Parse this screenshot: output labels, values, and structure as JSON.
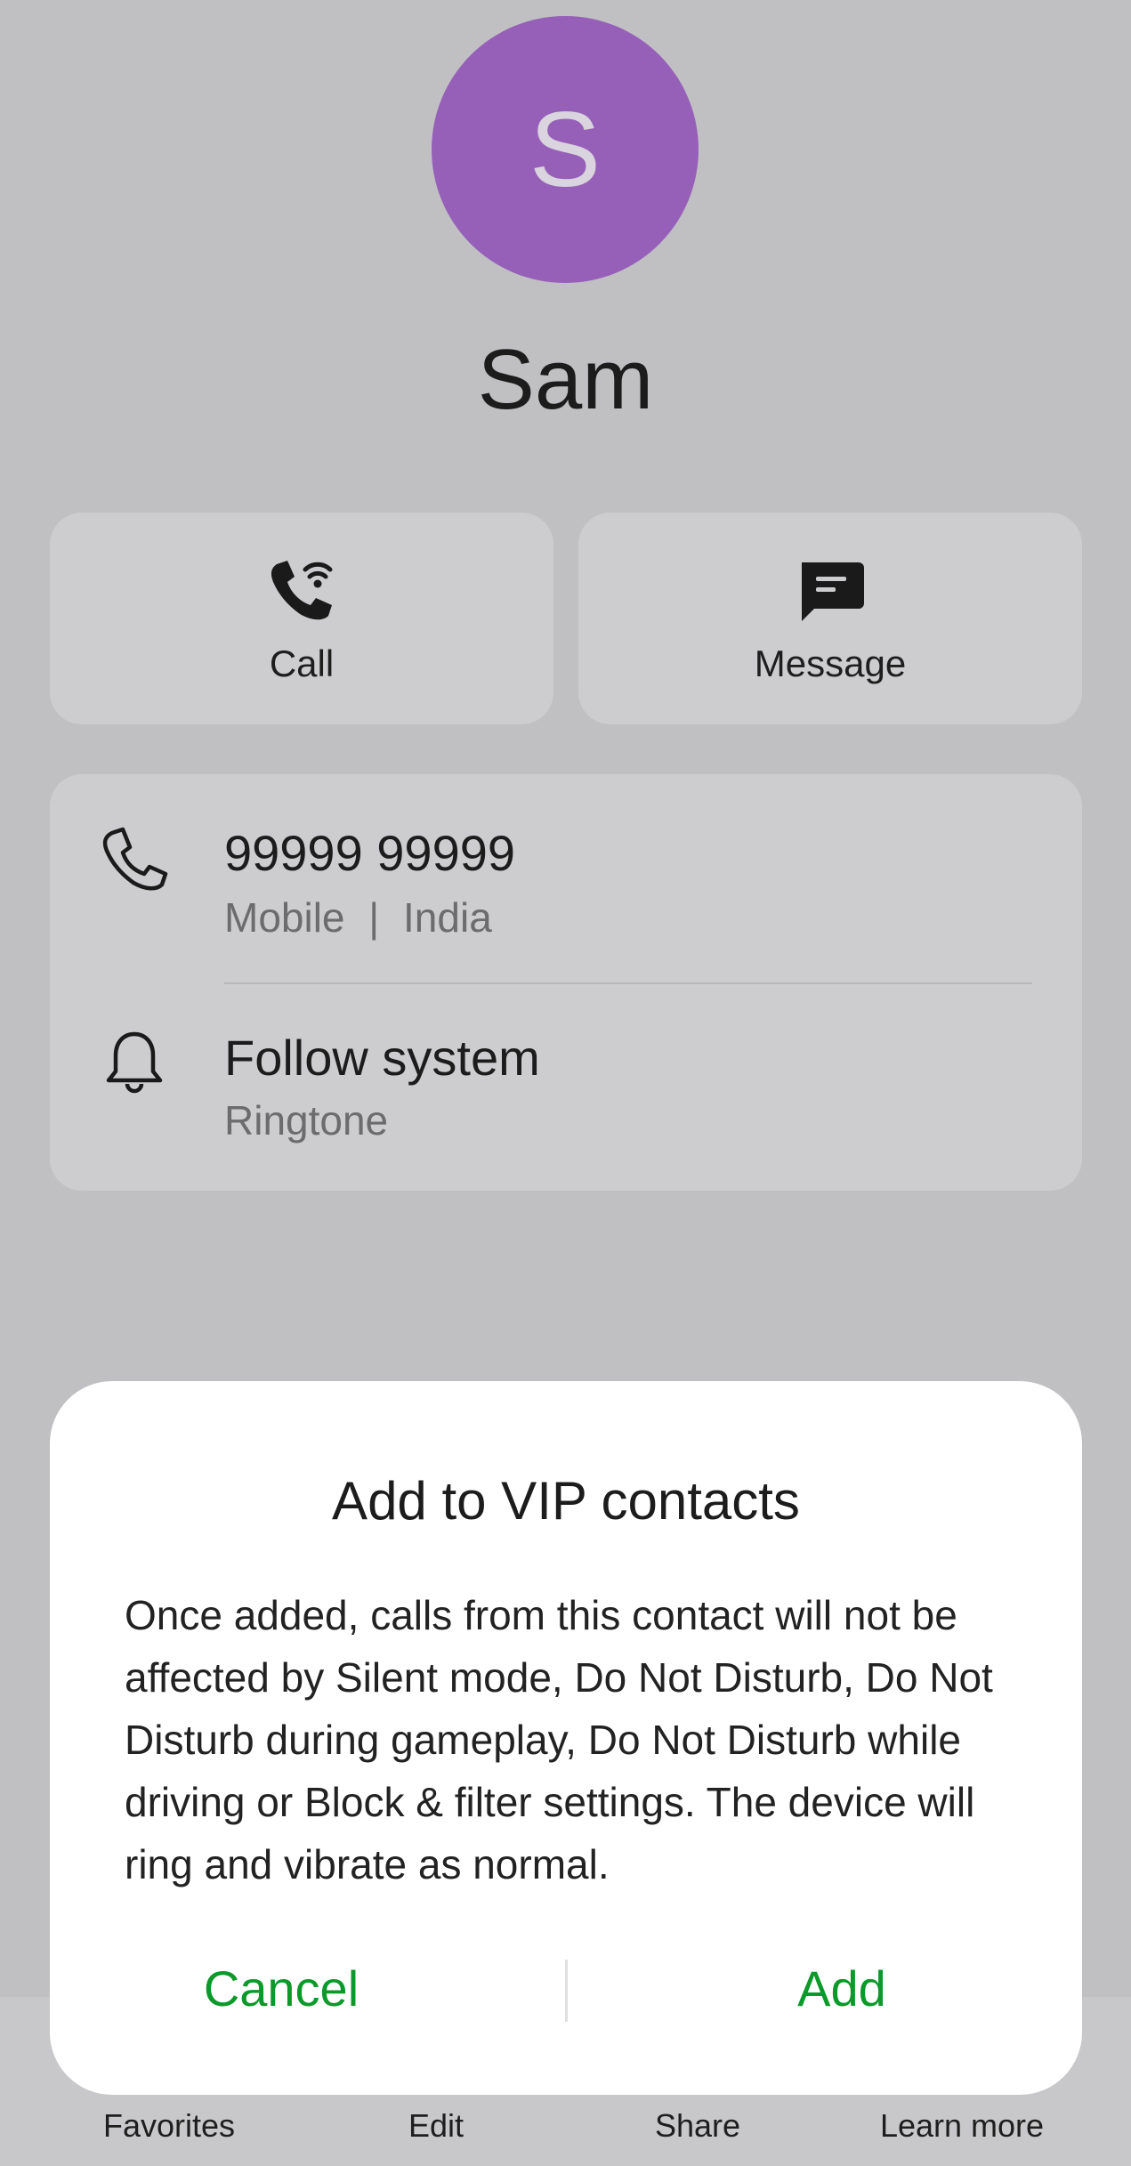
{
  "contact": {
    "initial": "S",
    "name": "Sam",
    "avatar_color": "#9660b9"
  },
  "actions": {
    "call_label": "Call",
    "message_label": "Message"
  },
  "details": {
    "phone_number": "99999 99999",
    "phone_type": "Mobile",
    "phone_separator": "|",
    "phone_region": "India",
    "ringtone_value": "Follow system",
    "ringtone_label": "Ringtone"
  },
  "bottom_bar": {
    "favorites": "Favorites",
    "edit": "Edit",
    "share": "Share",
    "learn_more": "Learn more"
  },
  "dialog": {
    "title": "Add to VIP contacts",
    "body": "Once added, calls from this contact will not be affected by Silent mode, Do Not Disturb, Do Not Disturb during gameplay, Do Not Disturb while driving or Block & filter settings. The device will ring and vibrate as normal.",
    "cancel_label": "Cancel",
    "add_label": "Add",
    "accent_color": "#0b9a2a"
  },
  "icons": {
    "call": "wifi-call-icon",
    "message": "message-icon",
    "phone": "phone-icon",
    "ringtone": "bell-icon"
  }
}
